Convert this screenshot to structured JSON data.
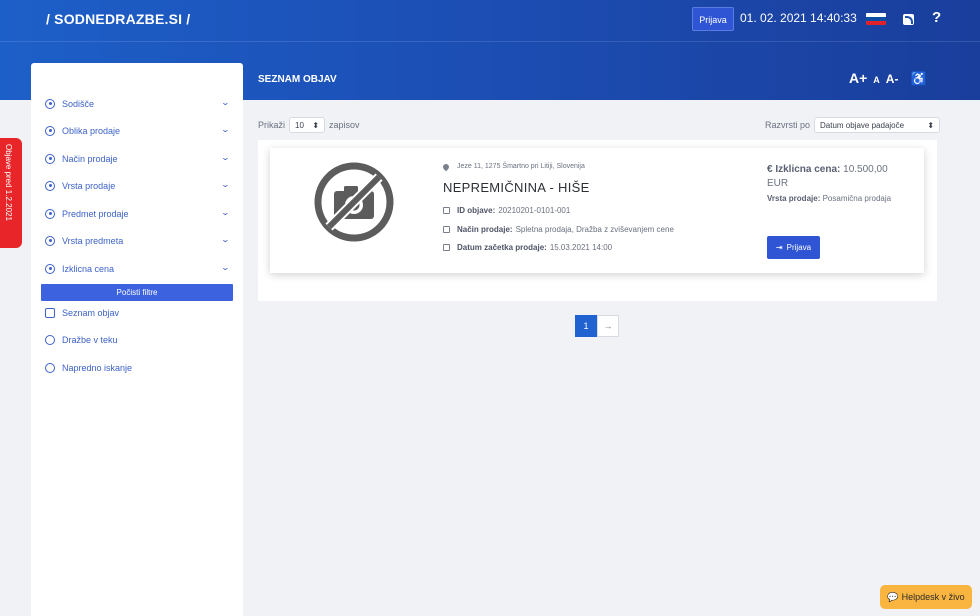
{
  "header": {
    "brand": "/ SODNEDRAZBE.SI /",
    "login_label": "Prijava",
    "datetime": "01. 02. 2021 14:40:33",
    "help_label": "?",
    "flag_colors": [
      "#ffffff",
      "#0b4ea2",
      "#e0232a"
    ]
  },
  "toolbar": {
    "title": "SEZNAM OBJAV",
    "font_increase": "A+",
    "font_normal": "A",
    "font_decrease": "A-",
    "accessibility_icon": "wheelchair-icon",
    "accessibility_glyph": "♿"
  },
  "side_tab": {
    "label": "Objave pred 1.2.2021"
  },
  "sidebar": {
    "filters": [
      {
        "label": "Sodišče"
      },
      {
        "label": "Oblika prodaje"
      },
      {
        "label": "Način prodaje"
      },
      {
        "label": "Vrsta prodaje"
      },
      {
        "label": "Predmet prodaje"
      },
      {
        "label": "Vrsta predmeta"
      },
      {
        "label": "Izklicna cena"
      }
    ],
    "chevron": "⌄",
    "clear_label": "Počisti filtre",
    "links": [
      {
        "label": "Seznam objav",
        "icon": "list-icon"
      },
      {
        "label": "Dražbe v teku",
        "icon": "clock-icon"
      },
      {
        "label": "Napredno iskanje",
        "icon": "search-icon"
      }
    ]
  },
  "controls": {
    "show_label": "Prikaži",
    "show_value": "10",
    "records_label": "zapisov",
    "sort_label": "Razvrsti po",
    "sort_value": "Datum objave padajoče",
    "select_arrow": "⬍"
  },
  "listing": {
    "address": "Jeze 11, 1275 Šmartno pri Litiji, Slovenija",
    "title": "NEPREMIČNINA - HIŠE",
    "id_label": "ID objave:",
    "id_value": "20210201-0101-001",
    "method_label": "Način prodaje:",
    "method_value": "Spletna prodaja, Dražba z zviševanjem cene",
    "start_label": "Datum začetka prodaje:",
    "start_value": "15.03.2021 14:00",
    "price_label": "€ Izklicna cena:",
    "price_value": "10.500,00",
    "price_currency": "EUR",
    "type_label": "Vrsta prodaje:",
    "type_value": "Posamična prodaja",
    "login_label": "Prijava",
    "login_glyph": "⇥",
    "image_icon": "no-camera-icon"
  },
  "pagination": {
    "current": "1",
    "next": "→"
  },
  "helpdesk": {
    "label": "Helpdesk v živo",
    "glyph": "💬"
  },
  "colors": {
    "primary": "#2f55d4",
    "header": "#1c4fb5",
    "tab": "#e8262a",
    "helpdesk": "#f9b53f"
  }
}
